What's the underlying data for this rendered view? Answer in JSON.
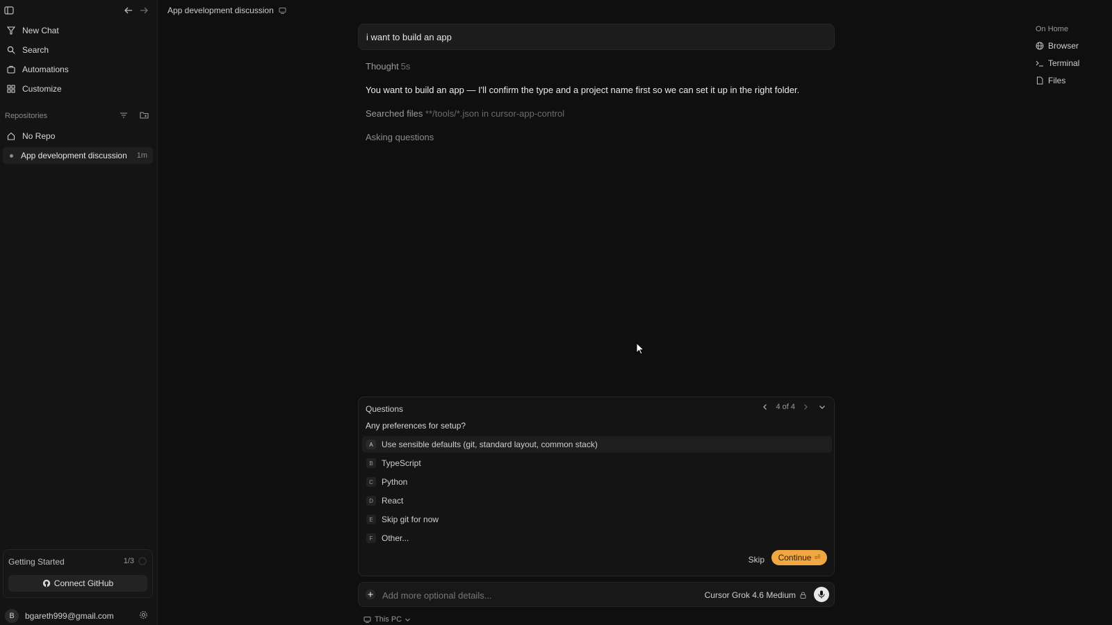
{
  "sidebar": {
    "nav": [
      {
        "label": "New Chat",
        "icon": "new-chat-icon"
      },
      {
        "label": "Search",
        "icon": "search-icon"
      },
      {
        "label": "Automations",
        "icon": "automations-icon"
      },
      {
        "label": "Customize",
        "icon": "customize-icon"
      }
    ],
    "repositories_label": "Repositories",
    "repos": [
      {
        "label": "No Repo",
        "icon": "home-icon"
      },
      {
        "label": "App development discussion",
        "time": "1m",
        "active": true
      }
    ],
    "getting_started": {
      "title": "Getting Started",
      "count": "1/3",
      "button": "Connect GitHub"
    },
    "account": {
      "initial": "B",
      "email": "bgareth999@gmail.com"
    }
  },
  "header": {
    "title": "App development discussion"
  },
  "right_panel": {
    "label": "On Home",
    "items": [
      {
        "label": "Browser",
        "icon": "globe-icon"
      },
      {
        "label": "Terminal",
        "icon": "terminal-icon"
      },
      {
        "label": "Files",
        "icon": "file-icon"
      }
    ]
  },
  "chat": {
    "user_message": "i want to build an app",
    "thought_label": "Thought",
    "thought_duration": "5s",
    "assistant_message": "You want to build an app — I'll confirm the type and a project name first so we can set it up in the right folder.",
    "searched_label": "Searched files",
    "searched_query": "**/tools/*.json in cursor-app-control",
    "asking": "Asking questions"
  },
  "questions": {
    "title": "Questions",
    "page": "4 of 4",
    "question": "Any preferences for setup?",
    "options": [
      {
        "key": "A",
        "label": "Use sensible defaults (git, standard layout, common stack)",
        "selected": true
      },
      {
        "key": "B",
        "label": "TypeScript"
      },
      {
        "key": "C",
        "label": "Python"
      },
      {
        "key": "D",
        "label": "React"
      },
      {
        "key": "E",
        "label": "Skip git for now"
      },
      {
        "key": "F",
        "label": "Other..."
      }
    ],
    "skip_label": "Skip",
    "continue_label": "Continue",
    "continue_shortcut": "⏎"
  },
  "composer": {
    "placeholder": "Add more optional details...",
    "model": "Cursor Grok 4.6 Medium",
    "environment": "This PC"
  },
  "colors": {
    "accent": "#f0a742",
    "background": "#0f0f0f",
    "sidebar": "#141414"
  }
}
